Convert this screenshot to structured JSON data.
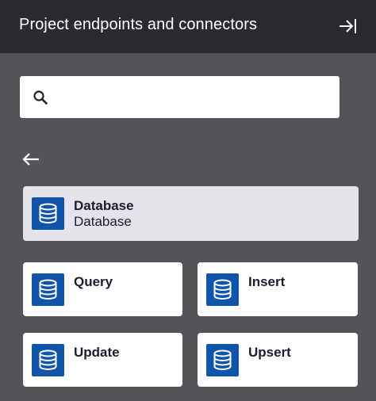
{
  "header": {
    "title": "Project endpoints and connectors",
    "collapse_icon": "collapse-panel-icon"
  },
  "search": {
    "value": "",
    "placeholder": "",
    "icon": "search-icon"
  },
  "navigation": {
    "back_icon": "arrow-left-icon"
  },
  "selected_connector": {
    "title": "Database",
    "subtitle": "Database",
    "icon": "database-icon"
  },
  "operations": [
    {
      "label": "Query",
      "icon": "database-icon"
    },
    {
      "label": "Insert",
      "icon": "database-icon"
    },
    {
      "label": "Update",
      "icon": "database-icon"
    },
    {
      "label": "Upsert",
      "icon": "database-icon"
    }
  ],
  "colors": {
    "header_bg": "#2b2b2f",
    "panel_bg": "#545458",
    "icon_bg": "#1155aa",
    "selected_card_bg": "#e4e4ea",
    "card_bg": "#ffffff"
  }
}
